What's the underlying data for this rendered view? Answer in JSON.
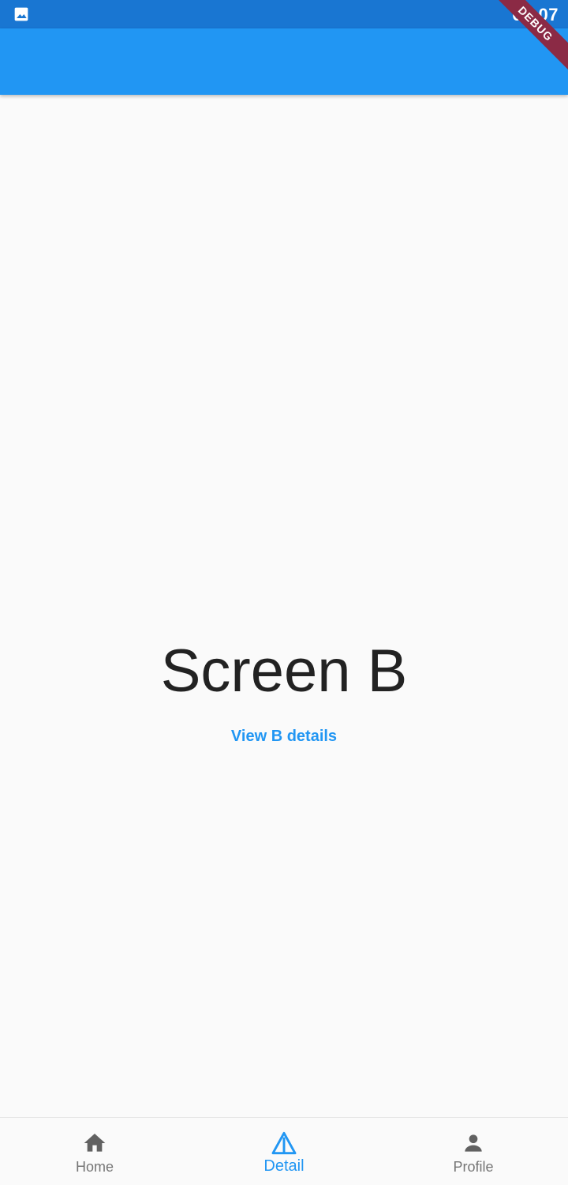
{
  "status_bar": {
    "time": "01:07",
    "notification_icon": "image-icon"
  },
  "debug_banner": "DEBUG",
  "main": {
    "title": "Screen B",
    "link_label": "View B details"
  },
  "bottom_nav": {
    "items": [
      {
        "label": "Home",
        "icon": "home-icon",
        "active": false
      },
      {
        "label": "Detail",
        "icon": "triangle-detail-icon",
        "active": true
      },
      {
        "label": "Profile",
        "icon": "person-icon",
        "active": false
      }
    ]
  },
  "colors": {
    "primary": "#2196f3",
    "status_bar": "#1976d2",
    "debug_banner": "#8b2a45",
    "inactive": "#757575"
  }
}
